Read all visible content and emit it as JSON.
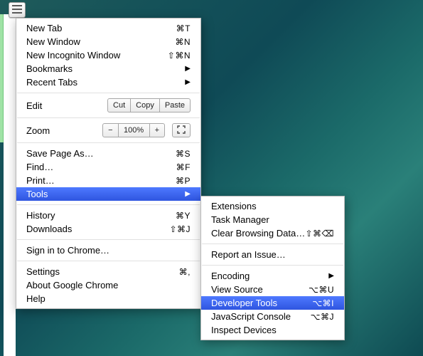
{
  "hamburger": {
    "name": "menu-icon"
  },
  "mainMenu": {
    "section1": [
      {
        "label": "New Tab",
        "shortcut": "⌘T"
      },
      {
        "label": "New Window",
        "shortcut": "⌘N"
      },
      {
        "label": "New Incognito Window",
        "shortcut": "⇧⌘N"
      },
      {
        "label": "Bookmarks",
        "submenu": true
      },
      {
        "label": "Recent Tabs",
        "submenu": true
      }
    ],
    "edit": {
      "label": "Edit",
      "cut": "Cut",
      "copy": "Copy",
      "paste": "Paste"
    },
    "zoom": {
      "label": "Zoom",
      "minus": "−",
      "value": "100%",
      "plus": "+"
    },
    "section2": [
      {
        "label": "Save Page As…",
        "shortcut": "⌘S"
      },
      {
        "label": "Find…",
        "shortcut": "⌘F"
      },
      {
        "label": "Print…",
        "shortcut": "⌘P"
      },
      {
        "label": "Tools",
        "submenu": true,
        "highlight": true
      }
    ],
    "section3": [
      {
        "label": "History",
        "shortcut": "⌘Y"
      },
      {
        "label": "Downloads",
        "shortcut": "⇧⌘J"
      }
    ],
    "section4": [
      {
        "label": "Sign in to Chrome…"
      }
    ],
    "section5": [
      {
        "label": "Settings",
        "shortcut": "⌘,"
      },
      {
        "label": "About Google Chrome"
      },
      {
        "label": "Help"
      }
    ]
  },
  "subMenu": {
    "group1": [
      {
        "label": "Extensions"
      },
      {
        "label": "Task Manager"
      },
      {
        "label": "Clear Browsing Data…",
        "shortcut": "⇧⌘⌫"
      }
    ],
    "group2": [
      {
        "label": "Report an Issue…"
      }
    ],
    "group3": [
      {
        "label": "Encoding",
        "submenu": true
      },
      {
        "label": "View Source",
        "shortcut": "⌥⌘U"
      },
      {
        "label": "Developer Tools",
        "shortcut": "⌥⌘I",
        "highlight": true
      },
      {
        "label": "JavaScript Console",
        "shortcut": "⌥⌘J"
      },
      {
        "label": "Inspect Devices"
      }
    ]
  }
}
